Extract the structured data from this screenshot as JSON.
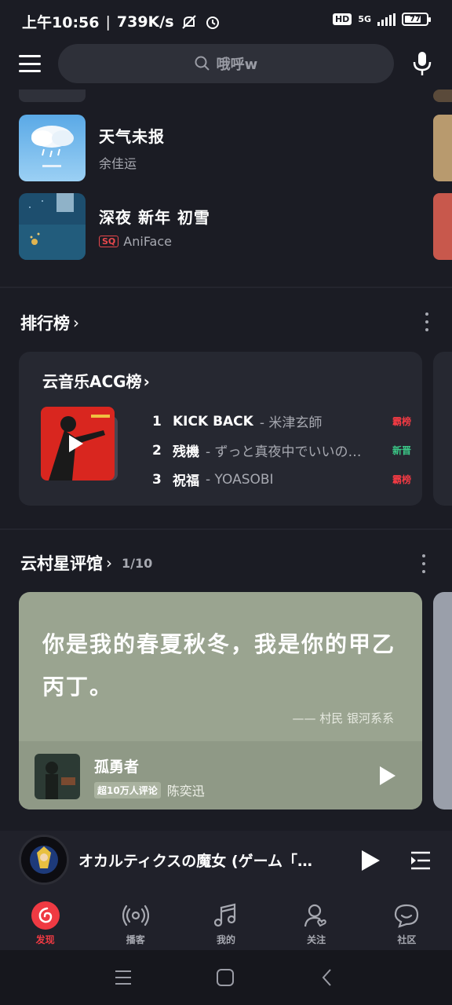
{
  "status_bar": {
    "time": "上午10:56",
    "net_speed": "739K/s",
    "hd": "HD",
    "network": "5G",
    "battery": "77",
    "battery_level": 0.77
  },
  "search": {
    "placeholder": "哦呼w"
  },
  "recommend_songs": [
    {
      "title": "天气未报",
      "artist": "余佳运",
      "badge": ""
    },
    {
      "title": "深夜 新年 初雪",
      "artist": "AniFace",
      "badge": "SQ"
    }
  ],
  "charts_section": {
    "title": "排行榜",
    "card_title": "云音乐ACG榜",
    "items": [
      {
        "rank": "1",
        "song": "KICK BACK",
        "artist": "- 米津玄師",
        "tag": "霸榜",
        "tag_color": "#ef3a43"
      },
      {
        "rank": "2",
        "song": "残機",
        "artist": "- ずっと真夜中でいいのに。",
        "tag": "新晋",
        "tag_color": "#3bc887"
      },
      {
        "rank": "3",
        "song": "祝福",
        "artist": "- YOASOBI",
        "tag": "霸榜",
        "tag_color": "#ef3a43"
      }
    ]
  },
  "comments_section": {
    "title": "云村星评馆",
    "count": "1/10",
    "quote": "你是我的春夏秋冬，我是你的甲乙丙丁。",
    "source": "—— 村民 银河系系",
    "song": "孤勇者",
    "badge": "超10万人评论",
    "artist": "陈奕迅"
  },
  "now_playing": {
    "title": "オカルティクスの魔女 (ゲーム「…"
  },
  "tabs": [
    {
      "label": "发现",
      "icon": "netease-logo-icon",
      "active": true
    },
    {
      "label": "播客",
      "icon": "podcast-icon",
      "active": false
    },
    {
      "label": "我的",
      "icon": "music-note-icon",
      "active": false
    },
    {
      "label": "关注",
      "icon": "follow-user-icon",
      "active": false
    },
    {
      "label": "社区",
      "icon": "community-icon",
      "active": false
    }
  ],
  "colors": {
    "background": "#1b1c24",
    "accent": "#ef3a43",
    "card": "#262831",
    "comment_card": "#9aa490"
  }
}
